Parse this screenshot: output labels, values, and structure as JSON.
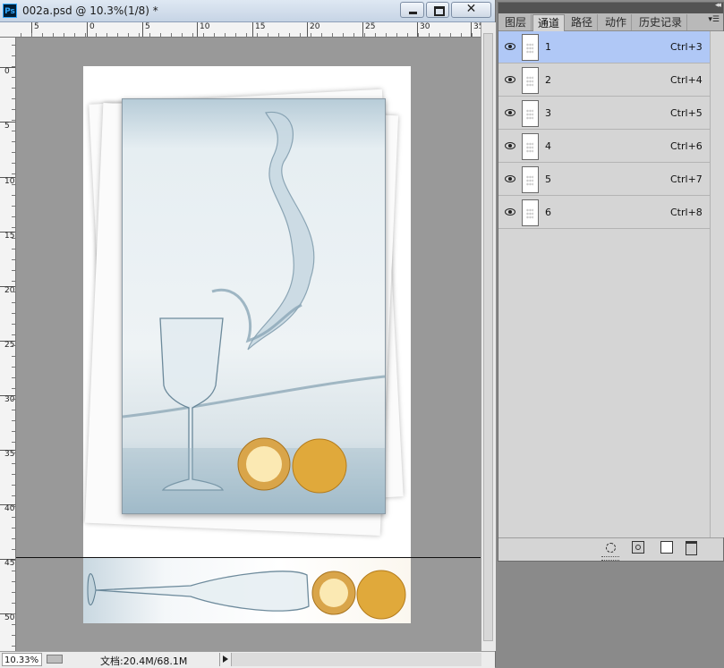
{
  "window": {
    "title": "002a.psd @ 10.3%(1/8) *",
    "app_icon": "Ps",
    "buttons": [
      "minimize-icon",
      "maximize-icon",
      "close-icon"
    ]
  },
  "rulers": {
    "top_labels": [
      "5",
      "0",
      "5",
      "10",
      "15",
      "20",
      "25",
      "30",
      "35"
    ],
    "left_labels": [
      "0",
      "5",
      "10",
      "15",
      "20",
      "25",
      "30",
      "35",
      "40",
      "45",
      "50"
    ]
  },
  "status_bar": {
    "zoom": "10.33%",
    "doc_size": "文档:20.4M/68.1M"
  },
  "panel": {
    "tabs": [
      "图层",
      "通道",
      "路径",
      "动作",
      "历史记录"
    ],
    "active_tab": 1,
    "channels": [
      {
        "name": "1",
        "shortcut": "Ctrl+3",
        "selected": true
      },
      {
        "name": "2",
        "shortcut": "Ctrl+4",
        "selected": false
      },
      {
        "name": "3",
        "shortcut": "Ctrl+5",
        "selected": false
      },
      {
        "name": "4",
        "shortcut": "Ctrl+6",
        "selected": false
      },
      {
        "name": "5",
        "shortcut": "Ctrl+7",
        "selected": false
      },
      {
        "name": "6",
        "shortcut": "Ctrl+8",
        "selected": false
      }
    ],
    "footer_icons": [
      "load-selection-icon",
      "save-selection-icon",
      "new-channel-icon",
      "delete-channel-icon"
    ]
  },
  "colors": {
    "selected_row": "#b0c8f6",
    "panel_bg": "#d5d5d5",
    "canvas_bg": "#999999"
  }
}
